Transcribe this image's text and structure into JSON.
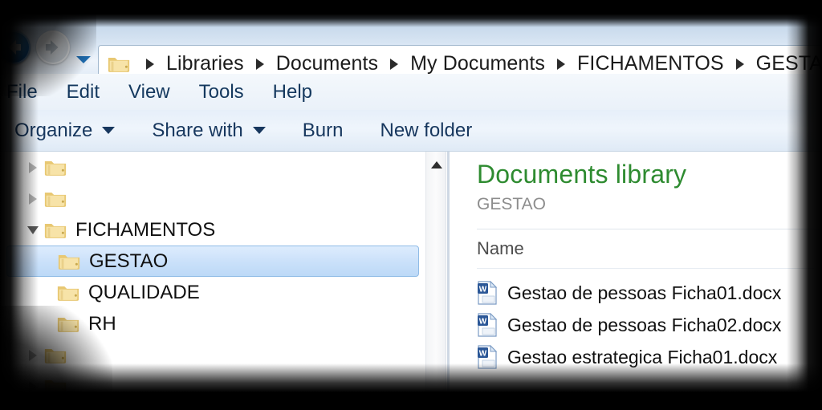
{
  "window": {
    "app": "Windows Explorer"
  },
  "nav": {
    "back_label": "Back",
    "forward_label": "Forward",
    "history_label": "Recent pages",
    "address_folder_icon": "folder-icon",
    "breadcrumb": [
      "Libraries",
      "Documents",
      "My Documents",
      "FICHAMENTOS",
      "GESTAO"
    ]
  },
  "menubar": {
    "items": [
      {
        "label": "File"
      },
      {
        "label": "Edit"
      },
      {
        "label": "View"
      },
      {
        "label": "Tools"
      },
      {
        "label": "Help"
      }
    ]
  },
  "toolbar": {
    "items": [
      {
        "label": "Organize",
        "caret": true
      },
      {
        "label": "Share with",
        "caret": true
      },
      {
        "label": "Burn",
        "caret": false
      },
      {
        "label": "New folder",
        "caret": false
      }
    ]
  },
  "tree": {
    "items": [
      {
        "label": "",
        "indent": 0,
        "twisty": "collapsed",
        "selected": false
      },
      {
        "label": "",
        "indent": 0,
        "twisty": "collapsed",
        "selected": false
      },
      {
        "label": "FICHAMENTOS",
        "indent": 0,
        "twisty": "expanded",
        "selected": false
      },
      {
        "label": "GESTAO",
        "indent": 1,
        "twisty": "none",
        "selected": true
      },
      {
        "label": "QUALIDADE",
        "indent": 1,
        "twisty": "none",
        "selected": false
      },
      {
        "label": "RH",
        "indent": 1,
        "twisty": "none",
        "selected": false
      },
      {
        "label": "",
        "indent": 0,
        "twisty": "collapsed",
        "selected": false
      },
      {
        "label": "",
        "indent": 0,
        "twisty": "collapsed",
        "selected": false
      }
    ],
    "scrollbar": {
      "up_arrow_icon": "scroll-up-arrow-icon"
    }
  },
  "list": {
    "title": "Documents library",
    "subtitle": "GESTAO",
    "column_headers": [
      "Name"
    ],
    "files": [
      {
        "name": "Gestao de pessoas Ficha01.docx",
        "icon": "word-document-icon"
      },
      {
        "name": "Gestao de pessoas Ficha02.docx",
        "icon": "word-document-icon"
      },
      {
        "name": "Gestao estrategica Ficha01.docx",
        "icon": "word-document-icon"
      }
    ]
  },
  "colors": {
    "library_title_green": "#2e8b30",
    "menu_text_navy": "#14385e",
    "selection_blue": "#bcd9f7",
    "folder_yellow": "#f2d98b"
  }
}
